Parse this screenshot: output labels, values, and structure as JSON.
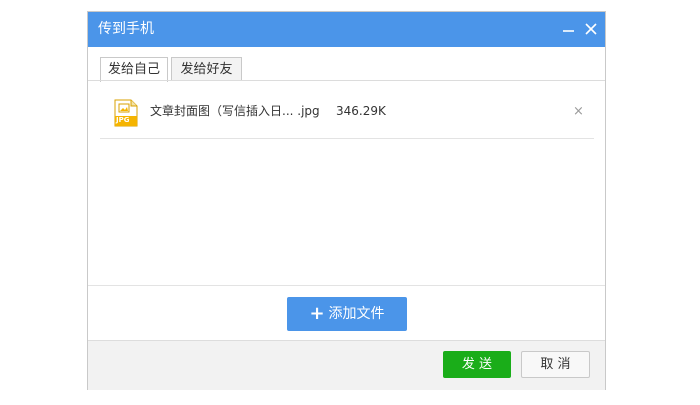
{
  "dialog": {
    "title": "传到手机"
  },
  "colors": {
    "titlebar": "#4b95e9",
    "primary_button": "#4b95e9",
    "send_button": "#1aad19",
    "file_icon": "#f5b400"
  },
  "tabs": [
    {
      "label": "发给自己",
      "active": true
    },
    {
      "label": "发给好友",
      "active": false
    }
  ],
  "file": {
    "icon": "jpg-file-icon",
    "icon_text": "JPG",
    "name": "文章封面图（写信插入日... .jpg",
    "size": "346.29K",
    "remove_label": "×"
  },
  "actions": {
    "add_icon": "+",
    "add_label": "添加文件",
    "send_label": "发 送",
    "cancel_label": "取 消"
  }
}
